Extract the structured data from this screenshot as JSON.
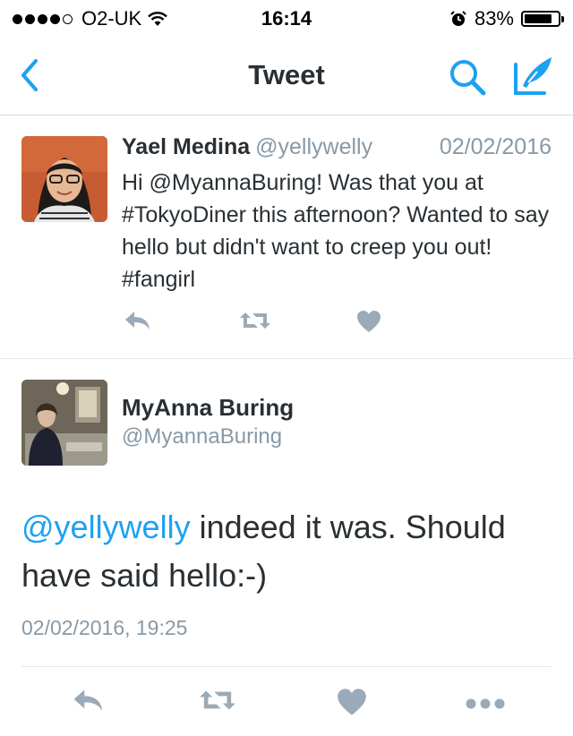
{
  "status_bar": {
    "carrier": "O2-UK",
    "time": "16:14",
    "battery": "83%",
    "battery_level": 0.83
  },
  "nav": {
    "title": "Tweet",
    "icons": [
      "back-chevron-icon",
      "search-icon",
      "compose-icon"
    ]
  },
  "original_tweet": {
    "name": "Yael Medina",
    "handle": "@yellywelly",
    "date": "02/02/2016",
    "text": "Hi @MyannaBuring! Was that you at #TokyoDiner this afternoon? Wanted to say hello but didn't want to creep you out! #fangirl",
    "actions": [
      "reply-icon",
      "retweet-icon",
      "like-icon"
    ]
  },
  "reply_tweet": {
    "name": "MyAnna Buring",
    "handle": "@MyannaBuring",
    "mention": "@yellywelly",
    "text": " indeed it was. Should have said hello:-)",
    "timestamp": "02/02/2016, 19:25",
    "actions": [
      "reply-icon",
      "retweet-icon",
      "like-icon",
      "more-icon"
    ]
  },
  "colors": {
    "accent": "#1da1f2",
    "text": "#292f33",
    "muted": "#8899a6",
    "icon": "#9aaab8",
    "divider": "#e1e8ed"
  }
}
